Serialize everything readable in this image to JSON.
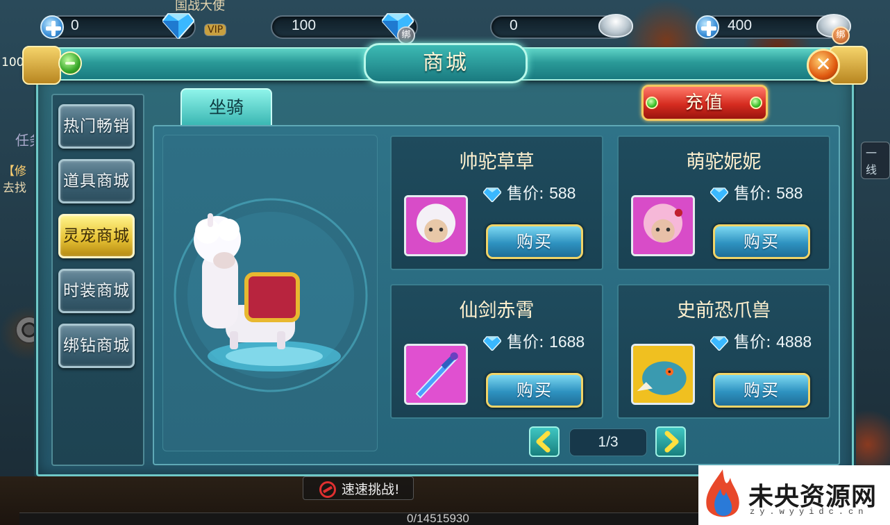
{
  "currency": {
    "diamond": "0",
    "bound_diamond": "100",
    "silver": "0",
    "bound_silver": "400",
    "bind_label": "绑"
  },
  "background": {
    "top_banner_text": "国战大使",
    "vip_text": "VIP",
    "left_text_1": "任务",
    "left_text_2": "【修",
    "left_text_3": "去找",
    "left_level": "100",
    "right_text": "一线",
    "chat_text": "速速挑战!",
    "exp_text": "0/14515930"
  },
  "window": {
    "title": "商城",
    "close_symbol": "✕"
  },
  "sidebar": {
    "items": [
      {
        "label": "热门畅销",
        "active": false
      },
      {
        "label": "道具商城",
        "active": false
      },
      {
        "label": "灵宠商城",
        "active": true
      },
      {
        "label": "时装商城",
        "active": false
      },
      {
        "label": "绑钻商城",
        "active": false
      }
    ]
  },
  "tabs": [
    {
      "label": "坐骑",
      "active": true
    }
  ],
  "recharge_label": "充值",
  "price_label": "售价: ",
  "buy_label": "购买",
  "products": [
    {
      "name": "帅驼草草",
      "price": "588",
      "thumb": "white-alpaca-icon"
    },
    {
      "name": "萌驼妮妮",
      "price": "588",
      "thumb": "pink-alpaca-icon"
    },
    {
      "name": "仙剑赤霄",
      "price": "1688",
      "thumb": "sword-icon"
    },
    {
      "name": "史前恐爪兽",
      "price": "4888",
      "thumb": "raptor-icon"
    }
  ],
  "pager": {
    "label": "1/3"
  },
  "watermark": {
    "title": "未央资源网",
    "url": "zy.wyyidc.cn"
  },
  "colors": {
    "frame": "#6fc9c8",
    "active_side": "#e8c436",
    "buy_border": "#f0d468",
    "recharge": "#d62c20"
  }
}
